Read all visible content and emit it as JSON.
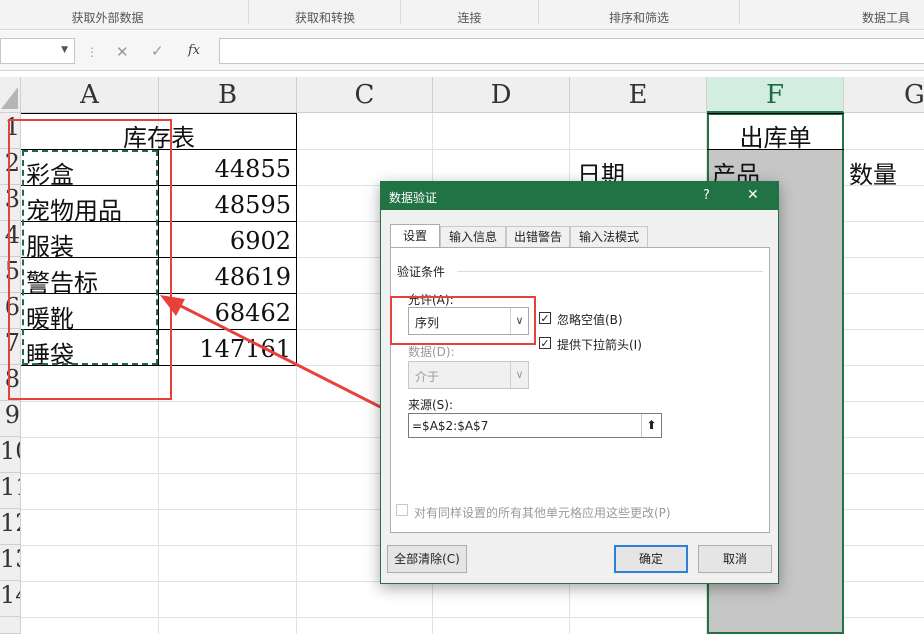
{
  "ribbon": {
    "groups": [
      "获取外部数据",
      "获取和转换",
      "连接",
      "排序和筛选",
      "数据工具"
    ]
  },
  "formula_bar": {
    "cancel_icon": "close-icon",
    "enter_icon": "check-icon",
    "fx_label": "fx"
  },
  "columns": [
    "A",
    "B",
    "C",
    "D",
    "E",
    "F",
    "G"
  ],
  "rows": [
    "1",
    "2",
    "3",
    "4",
    "5",
    "6",
    "7",
    "8",
    "9",
    "10",
    "11",
    "12",
    "13",
    "14"
  ],
  "sheet": {
    "inventory_title": "库存表",
    "items": [
      {
        "name": "彩盒",
        "qty": "44855"
      },
      {
        "name": "宠物用品",
        "qty": "48595"
      },
      {
        "name": "服装",
        "qty": "6902"
      },
      {
        "name": "警告标",
        "qty": "48619"
      },
      {
        "name": "暖靴",
        "qty": "68462"
      },
      {
        "name": "睡袋",
        "qty": "147161"
      }
    ],
    "outbound_title": "出库单",
    "date_header": "日期",
    "product_header": "产品",
    "qty_header": "数量"
  },
  "dialog": {
    "title": "数据验证",
    "help": "?",
    "close": "✕",
    "tabs": [
      "设置",
      "输入信息",
      "出错警告",
      "输入法模式"
    ],
    "section": "验证条件",
    "allow_label": "允许(A):",
    "allow_value": "序列",
    "ignore_blank": "忽略空值(B)",
    "dropdown_arrow": "提供下拉箭头(I)",
    "data_label": "数据(D):",
    "data_value": "介于",
    "source_label": "来源(S):",
    "source_value": "=$A$2:$A$7",
    "apply_all": "对有同样设置的所有其他单元格应用这些更改(P)",
    "clear_all": "全部清除(C)",
    "ok": "确定",
    "cancel": "取消"
  },
  "colors": {
    "excel_green": "#217346",
    "annotation_red": "#e8413c",
    "selection_dash": "#1e6b45"
  }
}
